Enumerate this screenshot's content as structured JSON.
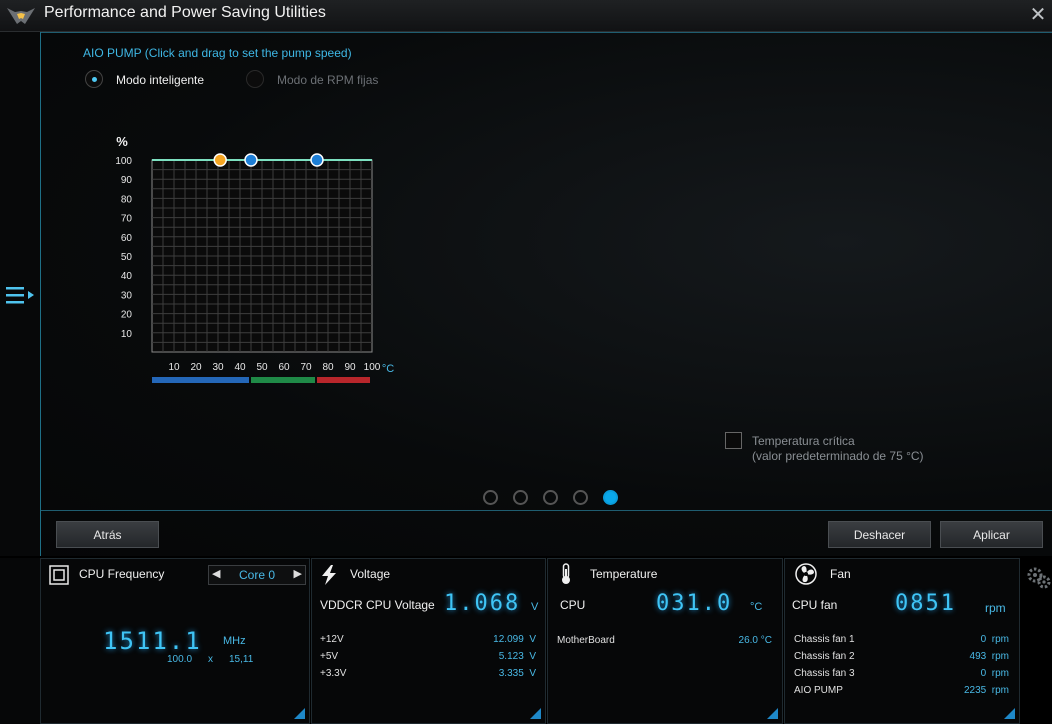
{
  "window": {
    "title": "Performance and Power Saving Utilities"
  },
  "pump": {
    "section_title": "AIO PUMP (Click and drag to set the pump speed)",
    "mode_smart": "Modo inteligente",
    "mode_fixed": "Modo de RPM fijas",
    "y_unit": "%",
    "x_unit": "°C",
    "critical_label_line1": "Temperatura crítica",
    "critical_label_line2": "(valor predeterminado de 75 °C)"
  },
  "chart_data": {
    "type": "line",
    "ylabel": "%",
    "xlabel": "°C",
    "xlim": [
      0,
      100
    ],
    "ylim": [
      0,
      100
    ],
    "x_ticks": [
      10,
      20,
      30,
      40,
      50,
      60,
      70,
      80,
      90,
      100
    ],
    "y_ticks": [
      10,
      20,
      30,
      40,
      50,
      60,
      70,
      80,
      90,
      100
    ],
    "series": [
      {
        "points": [
          [
            0,
            100
          ],
          [
            31,
            100
          ],
          [
            45,
            100
          ],
          [
            75,
            100
          ],
          [
            100,
            100
          ]
        ]
      }
    ],
    "control_points": [
      {
        "x": 31,
        "y": 100,
        "color": "#f5a623"
      },
      {
        "x": 45,
        "y": 100,
        "color": "#1e7fd6"
      },
      {
        "x": 75,
        "y": 100,
        "color": "#1e7fd6"
      }
    ],
    "zones": [
      {
        "from": 0,
        "to": 45,
        "color": "#2467b8"
      },
      {
        "from": 45,
        "to": 75,
        "color": "#1f8a47"
      },
      {
        "from": 75,
        "to": 100,
        "color": "#b8262b"
      }
    ],
    "grid": true
  },
  "buttons": {
    "back": "Atrás",
    "undo": "Deshacer",
    "apply": "Aplicar"
  },
  "cpu_freq": {
    "title": "CPU Frequency",
    "core_selector": "Core 0",
    "value": "1511.1",
    "unit": "MHz",
    "bclk": "100.0",
    "x": "x",
    "ratio": "15,11"
  },
  "voltage": {
    "title": "Voltage",
    "main_label": "VDDCR CPU Voltage",
    "main_value": "1.068",
    "main_unit": "V",
    "rows": [
      {
        "label": "+12V",
        "value": "12.099",
        "unit": "V"
      },
      {
        "label": "+5V",
        "value": "5.123",
        "unit": "V"
      },
      {
        "label": "+3.3V",
        "value": "3.335",
        "unit": "V"
      }
    ]
  },
  "temperature": {
    "title": "Temperature",
    "main_label": "CPU",
    "main_value": "031.0",
    "main_unit": "°C",
    "rows": [
      {
        "label": "MotherBoard",
        "value": "26.0 °C"
      }
    ]
  },
  "fan": {
    "title": "Fan",
    "main_label": "CPU fan",
    "main_value": "0851",
    "main_unit": "rpm",
    "rows": [
      {
        "label": "Chassis fan 1",
        "value": "0",
        "unit": "rpm"
      },
      {
        "label": "Chassis fan 2",
        "value": "493",
        "unit": "rpm"
      },
      {
        "label": "Chassis fan 3",
        "value": "0",
        "unit": "rpm"
      },
      {
        "label": "AIO PUMP",
        "value": "2235",
        "unit": "rpm"
      }
    ]
  },
  "pager": {
    "count": 5,
    "active": 4
  }
}
